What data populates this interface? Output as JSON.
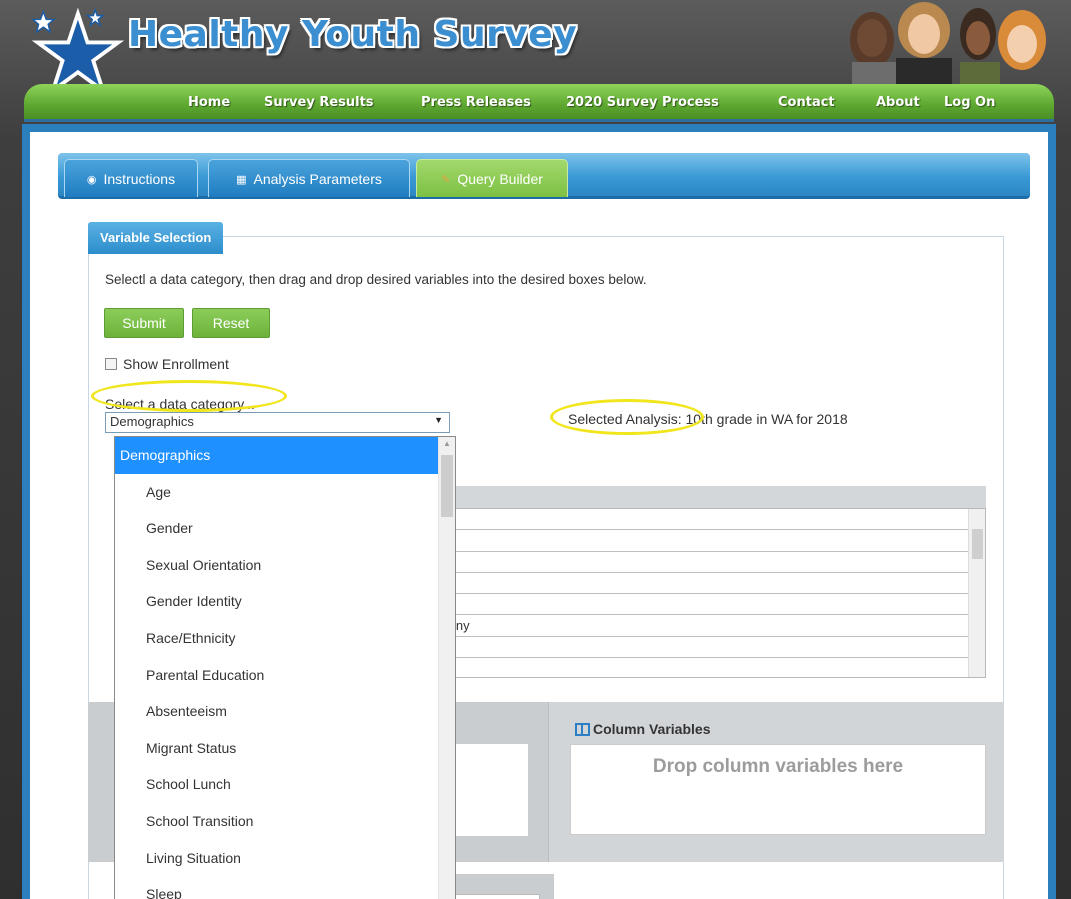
{
  "site": {
    "title": "Healthy Youth Survey",
    "nav": [
      "Home",
      "Survey Results",
      "Press Releases",
      "2020 Survey Process",
      "Contact",
      "About",
      "Log On"
    ]
  },
  "tabs": [
    {
      "label": "Instructions",
      "icon": "info-icon"
    },
    {
      "label": "Analysis Parameters",
      "icon": "grid-icon"
    },
    {
      "label": "Query Builder",
      "icon": "edit-icon",
      "active": true
    }
  ],
  "variable_selection": {
    "header": "Variable Selection",
    "instructions": "Selectl a data category, then drag and drop desired variables into the desired boxes below.",
    "submit_label": "Submit",
    "reset_label": "Reset",
    "show_enrollment_label": "Show Enrollment",
    "show_enrollment_checked": false,
    "category_prompt": "Select a data category...",
    "category_selected": "Demographics",
    "selected_analysis_label": "Selected Analysis:",
    "selected_analysis_value": "10th grade in WA for 2018"
  },
  "dropdown": {
    "group": "Demographics",
    "items": [
      "Age",
      "Gender",
      "Sexual Orientation",
      "Gender Identity",
      "Race/Ethnicity",
      "Parental Education",
      "Absenteeism",
      "Migrant Status",
      "School Lunch",
      "School Transition",
      "Living Situation",
      "Sleep"
    ]
  },
  "variable_list": {
    "partial_text": "iny"
  },
  "column_variables": {
    "title": "Column Variables",
    "placeholder": "Drop column variables here"
  },
  "colors": {
    "accent_blue": "#2b7fbd",
    "nav_green": "#5ea831",
    "button_green": "#7cc043",
    "dropdown_highlight": "#1e90ff",
    "annotation_yellow": "#f1e51b"
  }
}
